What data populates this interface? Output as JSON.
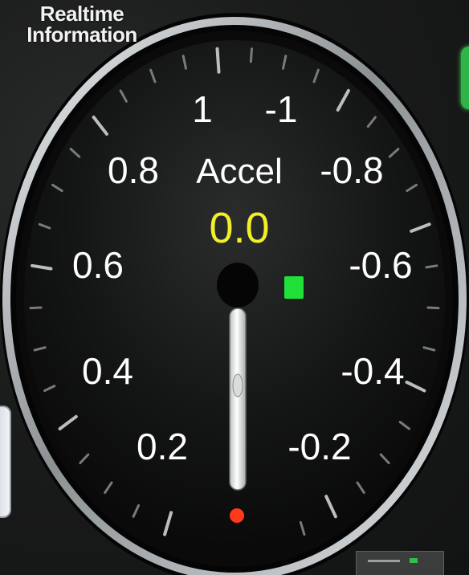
{
  "header": {
    "title": "Realtime\nInformation"
  },
  "gauge": {
    "title": "Accel",
    "value": "0.0",
    "needle_level": 0.0,
    "colors": {
      "value": "#f3ee2a",
      "indicator": "#22e03a",
      "warning_dot": "#ff3a1a",
      "bezel": "#c9ccce",
      "face": "#0f1010",
      "needle": "#e8e8e8",
      "hub": "#050505"
    },
    "left_labels": [
      "1",
      "0.8",
      "0.6",
      "0.4",
      "0.2"
    ],
    "right_labels": [
      "-1",
      "-0.8",
      "-0.6",
      "-0.4",
      "-0.2"
    ],
    "icons": {
      "status": "status-indicator-icon",
      "warning": "warning-dot-icon"
    }
  }
}
